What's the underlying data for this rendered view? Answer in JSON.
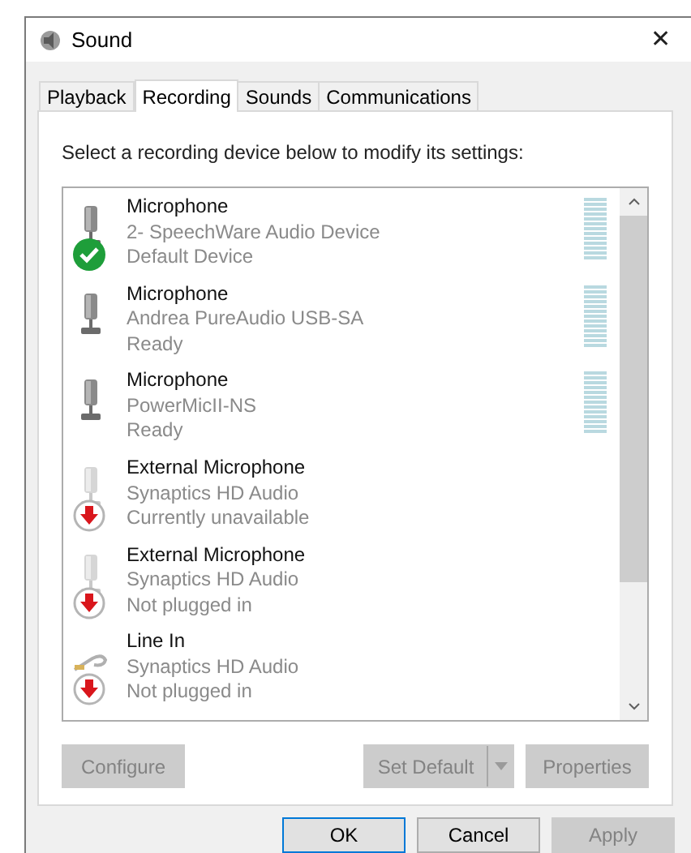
{
  "window": {
    "title": "Sound",
    "close": "✕"
  },
  "tabs": [
    {
      "label": "Playback",
      "selected": false
    },
    {
      "label": "Recording",
      "selected": true
    },
    {
      "label": "Sounds",
      "selected": false
    },
    {
      "label": "Communications",
      "selected": false
    }
  ],
  "instruction": "Select a recording device below to modify its settings:",
  "devices": [
    {
      "name": "Microphone",
      "driver": "2- SpeechWare Audio Device",
      "status": "Default Device",
      "kind": "microphone",
      "is_default": true,
      "unplugged": false,
      "meter": true
    },
    {
      "name": "Microphone",
      "driver": "Andrea PureAudio USB-SA",
      "status": "Ready",
      "kind": "microphone",
      "is_default": false,
      "unplugged": false,
      "meter": true
    },
    {
      "name": "Microphone",
      "driver": "PowerMicII-NS",
      "status": "Ready",
      "kind": "microphone",
      "is_default": false,
      "unplugged": false,
      "meter": true
    },
    {
      "name": "External Microphone",
      "driver": "Synaptics HD Audio",
      "status": "Currently unavailable",
      "kind": "microphone",
      "is_default": false,
      "unplugged": true,
      "meter": false
    },
    {
      "name": "External Microphone",
      "driver": "Synaptics HD Audio",
      "status": "Not plugged in",
      "kind": "microphone",
      "is_default": false,
      "unplugged": true,
      "meter": false
    },
    {
      "name": "Line In",
      "driver": "Synaptics HD Audio",
      "status": "Not plugged in",
      "kind": "line_in",
      "is_default": false,
      "unplugged": true,
      "meter": false
    }
  ],
  "device_buttons": [
    {
      "label": "Configure",
      "disabled": true
    },
    {
      "label": "Set Default",
      "disabled": true,
      "kind": "split"
    },
    {
      "label": "Properties",
      "disabled": true
    }
  ],
  "dialog_buttons": [
    {
      "label": "OK",
      "disabled": false,
      "default": true
    },
    {
      "label": "Cancel",
      "disabled": false,
      "default": false
    },
    {
      "label": "Apply",
      "disabled": true,
      "default": false
    }
  ]
}
